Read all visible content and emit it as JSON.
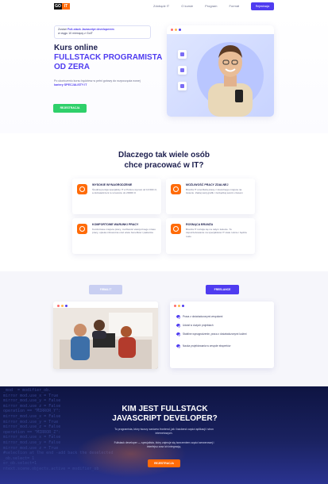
{
  "nav": {
    "logo_left": "GO",
    "logo_right": "IT",
    "links": [
      "Zdobądź IT",
      "O kursie",
      "Program",
      "Formát",
      "Ceny"
    ],
    "cta_label": "Rejestracja"
  },
  "hero": {
    "badge_line1_prefix": "Zostań ",
    "badge_line1_strong": "Full-stack Javascript developerem",
    "badge_line2": "w ciągu 10 miesięcy z GoIT",
    "title_line1": "Kurs online",
    "title_line2": "FULLSTACK PROGRAMISTA",
    "title_line3": "OD ZERA",
    "desc_prefix": "Po ukończeniu kursu będziesz w pełni gotowy do rozpoczęcia nowej ",
    "desc_strong": "kariery SPECJALISTY IT",
    "button_label": "REJESTRACJA"
  },
  "why": {
    "title_line1": "Dlaczego tak wiele osób",
    "title_line2": "chce pracować w IT?",
    "cards": [
      {
        "head": "WYSOKIE WYNAGRODZENIE",
        "text": "Średnia pensja specjalisty IT w Polsce wynosi od 10 000 zł, a doświadczeni to w kwocie do 20000 zł"
      },
      {
        "head": "MOŻLIWOŚĆ PRACY ZDALNEJ",
        "text": "Branża IT umożliwia pracę z dowolnego miejsca na świecie. Zadaj swój grafik i zarządzaj swoim czasem"
      },
      {
        "head": "KOMFORTOWE WARUNKI PRACY",
        "text": "Komfortowe miejsca pracy, możliwość elastycznego czasu pracy, opieka zdrowotna oraz wiele benefitów i pakietów"
      },
      {
        "head": "ROSNĄCA BRANŻA",
        "text": "Branża IT rozwija się na całym świecie. To zapotrzebowanie na specjalistów IT stale rośnie i będzie rosło"
      }
    ]
  },
  "section3": {
    "tab_left": "FIRMA IT",
    "tab_right": "FREELANCE",
    "list": [
      "Praca z doświadczonymi zespołami",
      "Udział w dużych projektach",
      "Stabilne wynagrodzenie, praca z doświadczonymi ludźmi",
      "Nauka projektowania w zespole ekspertów"
    ]
  },
  "dark": {
    "title_line1": "KIM JEST FULLSTACK",
    "title_line2": "JAVASCRIPT DEVELOPER?",
    "p1": "To programista, który tworzy zarówno frontend, jak i backend części aplikacji i stron internetowych.",
    "p2": "Fullstack developer — specjalista, który zajmuje się tworzeniem części serwerowej i interfejsu oraz ich integracją.",
    "button_label": "REJESTRACJA",
    "code_lines": [
      "_mod  = modifier_ob.",
      "mirror mod.use_x = True",
      "mirror_mod.use_y = False",
      "mirror_mod.use_z = False",
      "operation == \"MIRROR_Y\":",
      "mirror_mod.use_x = False",
      "mirror_mod.use_y = True",
      "mirror_mod.use_z = False",
      "operation == \"MIRROR_Z\":",
      "mirror_mod.use_x = False",
      "mirror_mod.use_y = False",
      "mirror_mod.use_z = True",
      "",
      "#selection at the end -add back the deselected",
      "_ob.select= 1",
      "er_ob.select=1",
      "ntext.scene.objects.active = modifier_ob"
    ]
  },
  "colors": {
    "accent": "#4f3cf0",
    "orange": "#ff6b08",
    "green": "#2fd06a",
    "dark_bg": "#0e1442"
  }
}
